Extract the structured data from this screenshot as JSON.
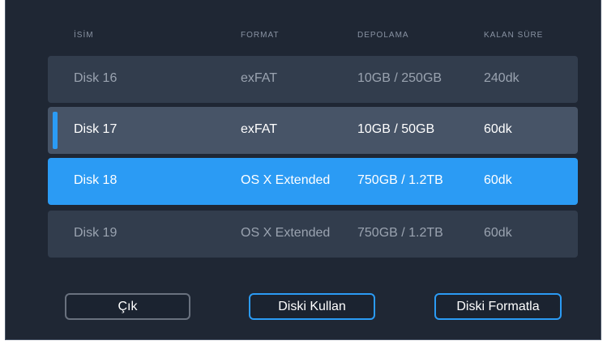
{
  "columns": {
    "name": "İSİM",
    "format": "FORMAT",
    "storage": "DEPOLAMA",
    "remaining": "KALAN SÜRE"
  },
  "disks": [
    {
      "name": "Disk 16",
      "format": "exFAT",
      "storage": "10GB / 250GB",
      "remaining": "240dk"
    },
    {
      "name": "Disk 17",
      "format": "exFAT",
      "storage": "10GB / 50GB",
      "remaining": "60dk"
    },
    {
      "name": "Disk 18",
      "format": "OS X Extended",
      "storage": "750GB / 1.2TB",
      "remaining": "60dk"
    },
    {
      "name": "Disk 19",
      "format": "OS X Extended",
      "storage": "750GB / 1.2TB",
      "remaining": "60dk"
    }
  ],
  "buttons": {
    "exit": "Çık",
    "use_disk": "Diski Kullan",
    "format_disk": "Diski Formatla"
  },
  "colors": {
    "panel_bg": "#1f2734",
    "row_bg": "#323d4d",
    "row_active_bg": "#475467",
    "accent": "#2b9bf4"
  }
}
